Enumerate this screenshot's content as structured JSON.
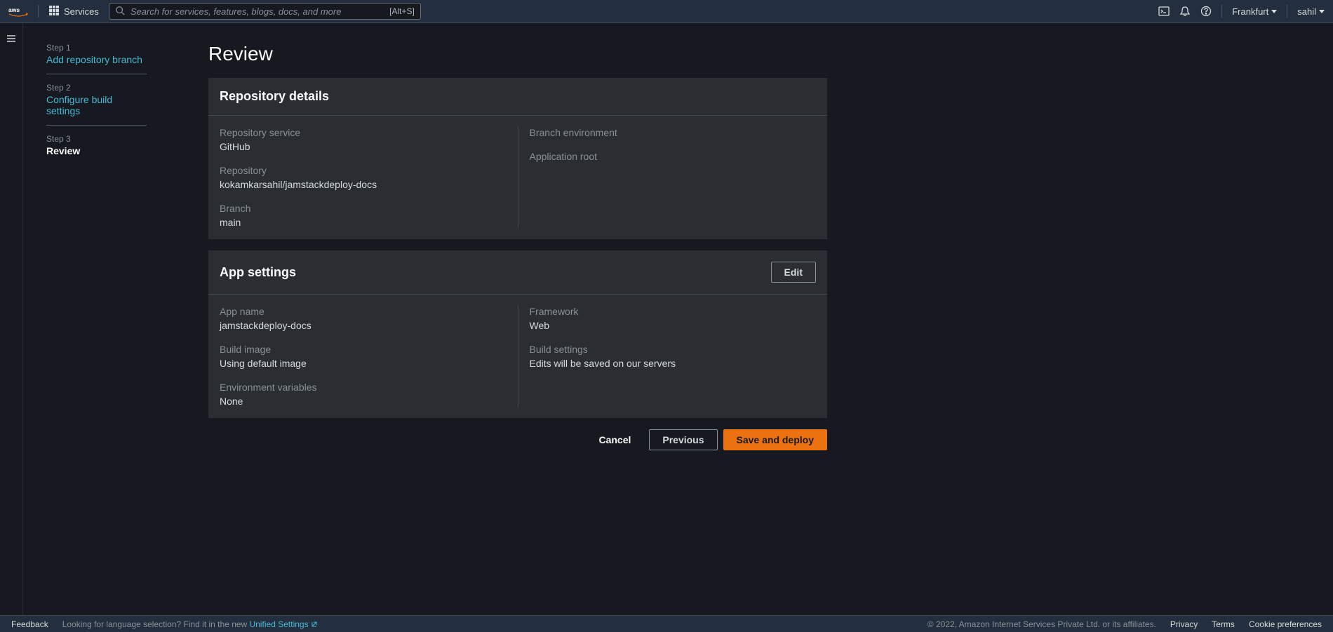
{
  "topnav": {
    "services_label": "Services",
    "search_placeholder": "Search for services, features, blogs, docs, and more",
    "search_shortcut": "[Alt+S]",
    "region": "Frankfurt",
    "user": "sahil"
  },
  "steps": {
    "s1_num": "Step 1",
    "s1_label": "Add repository branch",
    "s2_num": "Step 2",
    "s2_label": "Configure build settings",
    "s3_num": "Step 3",
    "s3_label": "Review"
  },
  "page": {
    "title": "Review"
  },
  "repo_panel": {
    "title": "Repository details",
    "fields": {
      "service_label": "Repository service",
      "service_value": "GitHub",
      "repo_label": "Repository",
      "repo_value": "kokamkarsahil/jamstackdeploy-docs",
      "branch_label": "Branch",
      "branch_value": "main",
      "branch_env_label": "Branch environment",
      "branch_env_value": "",
      "app_root_label": "Application root",
      "app_root_value": ""
    }
  },
  "app_panel": {
    "title": "App settings",
    "edit_label": "Edit",
    "fields": {
      "app_name_label": "App name",
      "app_name_value": "jamstackdeploy-docs",
      "build_image_label": "Build image",
      "build_image_value": "Using default image",
      "env_vars_label": "Environment variables",
      "env_vars_value": "None",
      "framework_label": "Framework",
      "framework_value": "Web",
      "build_settings_label": "Build settings",
      "build_settings_value": "Edits will be saved on our servers"
    }
  },
  "actions": {
    "cancel": "Cancel",
    "previous": "Previous",
    "save_deploy": "Save and deploy"
  },
  "footer": {
    "feedback": "Feedback",
    "lang_prefix": "Looking for language selection? Find it in the new ",
    "lang_link": "Unified Settings",
    "copyright": "© 2022, Amazon Internet Services Private Ltd. or its affiliates.",
    "privacy": "Privacy",
    "terms": "Terms",
    "cookie": "Cookie preferences"
  }
}
